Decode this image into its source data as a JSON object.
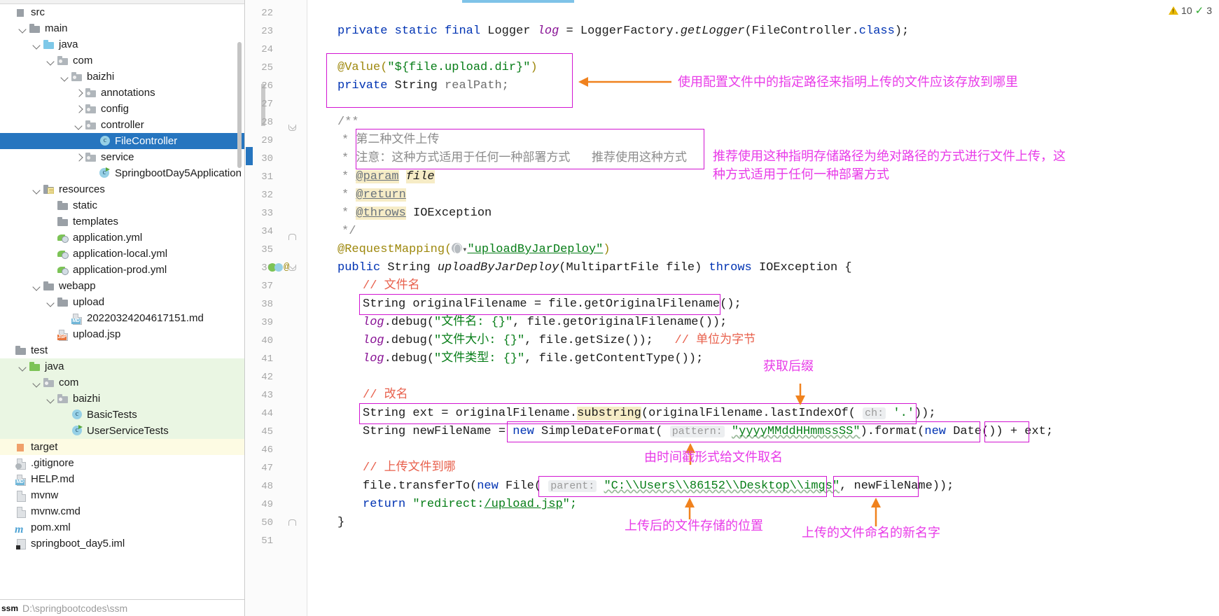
{
  "sidebar": {
    "scroll_path": "D:\\springbootcodes\\ssm",
    "scroll_badge": "ssm",
    "items": [
      {
        "label": "src",
        "indent": 0,
        "arrow": "none",
        "icon": "src-icon",
        "state": "normal"
      },
      {
        "label": "main",
        "indent": 1,
        "arrow": "down",
        "icon": "folder-icon",
        "state": "normal"
      },
      {
        "label": "java",
        "indent": 2,
        "arrow": "down",
        "icon": "folder-blue-icon",
        "state": "normal"
      },
      {
        "label": "com",
        "indent": 3,
        "arrow": "down",
        "icon": "package-icon",
        "state": "normal"
      },
      {
        "label": "baizhi",
        "indent": 4,
        "arrow": "down",
        "icon": "package-icon",
        "state": "normal"
      },
      {
        "label": "annotations",
        "indent": 5,
        "arrow": "right",
        "icon": "package-icon",
        "state": "normal"
      },
      {
        "label": "config",
        "indent": 5,
        "arrow": "right",
        "icon": "package-icon",
        "state": "normal"
      },
      {
        "label": "controller",
        "indent": 5,
        "arrow": "down",
        "icon": "package-icon",
        "state": "normal"
      },
      {
        "label": "FileController",
        "indent": 6,
        "arrow": "none",
        "icon": "java-class-icon",
        "state": "selected"
      },
      {
        "label": "service",
        "indent": 5,
        "arrow": "right",
        "icon": "package-icon",
        "state": "normal"
      },
      {
        "label": "SpringbootDay5Application",
        "indent": 6,
        "arrow": "none",
        "icon": "spring-boot-class-icon",
        "state": "normal"
      },
      {
        "label": "resources",
        "indent": 2,
        "arrow": "down",
        "icon": "resources-folder-icon",
        "state": "normal"
      },
      {
        "label": "static",
        "indent": 3,
        "arrow": "none",
        "icon": "folder-icon",
        "state": "normal"
      },
      {
        "label": "templates",
        "indent": 3,
        "arrow": "none",
        "icon": "folder-icon",
        "state": "normal"
      },
      {
        "label": "application.yml",
        "indent": 3,
        "arrow": "none",
        "icon": "yaml-spring-icon",
        "state": "normal"
      },
      {
        "label": "application-local.yml",
        "indent": 3,
        "arrow": "none",
        "icon": "yaml-spring-icon",
        "state": "normal"
      },
      {
        "label": "application-prod.yml",
        "indent": 3,
        "arrow": "none",
        "icon": "yaml-spring-icon",
        "state": "normal"
      },
      {
        "label": "webapp",
        "indent": 2,
        "arrow": "down",
        "icon": "folder-icon",
        "state": "normal"
      },
      {
        "label": "upload",
        "indent": 3,
        "arrow": "down",
        "icon": "folder-icon",
        "state": "normal"
      },
      {
        "label": "20220324204617151.md",
        "indent": 4,
        "arrow": "none",
        "icon": "markdown-file-icon",
        "state": "normal"
      },
      {
        "label": "upload.jsp",
        "indent": 3,
        "arrow": "none",
        "icon": "jsp-file-icon",
        "state": "normal"
      },
      {
        "label": "test",
        "indent": 0,
        "arrow": "none",
        "icon": "folder-icon",
        "state": "normal"
      },
      {
        "label": "java",
        "indent": 1,
        "arrow": "down",
        "icon": "folder-green-icon",
        "state": "test"
      },
      {
        "label": "com",
        "indent": 2,
        "arrow": "down",
        "icon": "package-icon",
        "state": "test"
      },
      {
        "label": "baizhi",
        "indent": 3,
        "arrow": "down",
        "icon": "package-icon",
        "state": "test"
      },
      {
        "label": "BasicTests",
        "indent": 4,
        "arrow": "none",
        "icon": "java-class-icon",
        "state": "test"
      },
      {
        "label": "UserServiceTests",
        "indent": 4,
        "arrow": "none",
        "icon": "java-class-run-icon",
        "state": "test"
      },
      {
        "label": "target",
        "indent": 0,
        "arrow": "none",
        "icon": "target-folder-icon",
        "state": "excluded"
      },
      {
        "label": ".gitignore",
        "indent": 0,
        "arrow": "none",
        "icon": "gitignore-file-icon",
        "state": "normal"
      },
      {
        "label": "HELP.md",
        "indent": 0,
        "arrow": "none",
        "icon": "markdown-file-icon",
        "state": "normal"
      },
      {
        "label": "mvnw",
        "indent": 0,
        "arrow": "none",
        "icon": "file-icon",
        "state": "normal"
      },
      {
        "label": "mvnw.cmd",
        "indent": 0,
        "arrow": "none",
        "icon": "cmd-file-icon",
        "state": "normal"
      },
      {
        "label": "pom.xml",
        "indent": 0,
        "arrow": "none",
        "icon": "maven-file-icon",
        "state": "normal"
      },
      {
        "label": "springboot_day5.iml",
        "indent": 0,
        "arrow": "none",
        "icon": "iml-file-icon",
        "state": "normal"
      }
    ]
  },
  "inspections": {
    "warning_icon": "warning-triangle-icon",
    "warning_count": "10",
    "check_icon": "check-mark-icon",
    "check_count": "3"
  },
  "editor": {
    "line_numbers": [
      "22",
      "23",
      "24",
      "25",
      "26",
      "27",
      "28",
      "29",
      "30",
      "31",
      "32",
      "33",
      "34",
      "35",
      "36",
      "37",
      "38",
      "39",
      "40",
      "41",
      "42",
      "43",
      "44",
      "45",
      "46",
      "47",
      "48",
      "49",
      "50",
      "51"
    ],
    "lines": [
      {
        "n": "22",
        "text": ""
      },
      {
        "n": "23",
        "text": "    private static final Logger log = LoggerFactory.getLogger(FileController.class);"
      },
      {
        "n": "24",
        "text": ""
      },
      {
        "n": "25",
        "text": "    @Value(\"${file.upload.dir}\")"
      },
      {
        "n": "26",
        "text": "    private String realPath;"
      },
      {
        "n": "27",
        "text": ""
      },
      {
        "n": "28",
        "text": "    /**"
      },
      {
        "n": "29",
        "text": "     * 第二种文件上传"
      },
      {
        "n": "30",
        "text": "     * 注意：这种方式适用于任何一种部署方式   推荐使用这种方式"
      },
      {
        "n": "31",
        "text": "     * @param file"
      },
      {
        "n": "32",
        "text": "     * @return"
      },
      {
        "n": "33",
        "text": "     * @throws IOException"
      },
      {
        "n": "34",
        "text": "     */"
      },
      {
        "n": "35",
        "text": "    @RequestMapping(\"uploadByJarDeploy\")"
      },
      {
        "n": "36",
        "text": "    public String uploadByJarDeploy(MultipartFile file) throws IOException {"
      },
      {
        "n": "37",
        "text": "        // 文件名"
      },
      {
        "n": "38",
        "text": "        String originalFilename = file.getOriginalFilename();"
      },
      {
        "n": "39",
        "text": "        log.debug(\"文件名: {}\", file.getOriginalFilename());"
      },
      {
        "n": "40",
        "text": "        log.debug(\"文件大小: {}\", file.getSize());   // 单位为字节"
      },
      {
        "n": "41",
        "text": "        log.debug(\"文件类型: {}\", file.getContentType());"
      },
      {
        "n": "42",
        "text": ""
      },
      {
        "n": "43",
        "text": "        // 改名"
      },
      {
        "n": "44",
        "text": "        String ext = originalFilename.substring(originalFilename.lastIndexOf( ch: '.'));"
      },
      {
        "n": "45",
        "text": "        String newFileName = new SimpleDateFormat( pattern: \"yyyyMMddHHmmssSS\").format(new Date()) + ext;"
      },
      {
        "n": "46",
        "text": ""
      },
      {
        "n": "47",
        "text": "        // 上传文件到哪"
      },
      {
        "n": "48",
        "text": "        file.transferTo(new File( parent: \"C:\\\\Users\\\\86152\\\\Desktop\\\\imgs\", newFileName));"
      },
      {
        "n": "49",
        "text": "        return \"redirect:/upload.jsp\";"
      },
      {
        "n": "50",
        "text": "    }"
      },
      {
        "n": "51",
        "text": ""
      }
    ],
    "tokens": {
      "l23_private": "private",
      "l23_static": "static",
      "l23_final": "final",
      "l23_logger": "Logger",
      "l23_log": "log",
      "l23_eq": "= LoggerFactory.",
      "l23_getlogger": "getLogger",
      "l23_rest": "(FileController.",
      "l23_class": "class",
      ";": ");",
      "l25_value": "@Value(",
      "l25_str": "\"${file.upload.dir}\"",
      "l25_close": ")",
      "l26_private": "private",
      "l26_string": "String",
      "l26_realpath": "realPath;",
      "l28": "/**",
      "l29_star": "*",
      "l29_cn": "第二种文件上传",
      "l30_star": "*",
      "l30_cn": "注意：这种方式适用于任何一种部署方式   推荐使用这种方式",
      "l31_star": "*",
      "l31_tag": "@param",
      "l31_val": "file",
      "l32_star": "*",
      "l32_tag": "@return",
      "l33_star": "*",
      "l33_tag": "@throws",
      "l33_val": "IOException",
      "l34": "*/",
      "l35_ann": "@RequestMapping(",
      "l35_globe": "globe-icon",
      "l35_str": "\"uploadByJarDeploy\"",
      "l35_close": ")",
      "l36_public": "public",
      "l36_string": "String",
      "l36_name": "uploadByJarDeploy",
      "l36_args": "(MultipartFile file)",
      "l36_throws": "throws",
      "l36_ex": "IOException {",
      "l37": "// 文件名",
      "l38": "String originalFilename = file.getOriginalFilename();",
      "l39_log": "log",
      "l39_rest": ".debug(",
      "l39_str": "\"文件名: {}\"",
      "l39_tail": ", file.getOriginalFilename());",
      "l40_log": "log",
      "l40_rest": ".debug(",
      "l40_str": "\"文件大小: {}\"",
      "l40_tail": ", file.getSize());",
      "l40_cmt": "// 单位为字节",
      "l41_log": "log",
      "l41_rest": ".debug(",
      "l41_str": "\"文件类型: {}\"",
      "l41_tail": ", file.getContentType());",
      "l43": "// 改名",
      "l44_a": "String ext = originalFilename.",
      "l44_sub": "substring",
      "l44_b": "(originalFilename.lastIndexOf(",
      "l44_hint": "ch:",
      "l44_c": "'.'",
      "l44_d": "));",
      "l45_a": "String newFileName = ",
      "l45_new": "new",
      "l45_b": " SimpleDateFormat(",
      "l45_hint": "pattern:",
      "l45_str": "\"yyyyMMddHHmmssSS\"",
      "l45_c": ").format(",
      "l45_new2": "new",
      "l45_d": " Date())",
      "l45_plus": "+",
      "l45_ext": "ext;",
      "l47": "// 上传文件到哪",
      "l48_a": "file.transferTo(",
      "l48_new": "new",
      "l48_b": " File(",
      "l48_hint": "parent:",
      "l48_path": "\"C:\\\\Users\\\\86152\\\\Desktop\\\\imgs\"",
      "l48_comma": ",",
      "l48_name": "newFileName",
      "l48_close": "));",
      "l49_ret": "return",
      "l49_str_a": "\"redirect:",
      "l49_link": "/upload.jsp",
      "l49_str_b": "\";",
      "l50": "}"
    }
  },
  "annotations": [
    {
      "id": "anno-value-path",
      "text": "使用配置文件中的指定路径来指明上传的文件应该存放到哪里"
    },
    {
      "id": "anno-recommend",
      "text": "推荐使用这种指明存储路径为绝对路径的方式进行文件上传，这\n种方式适用于任何一种部署方式"
    },
    {
      "id": "anno-get-ext",
      "text": "获取后缀"
    },
    {
      "id": "anno-timestamp-name",
      "text": "由时间戳形式给文件取名"
    },
    {
      "id": "anno-storage-location",
      "text": "上传后的文件存储的位置"
    },
    {
      "id": "anno-new-filename",
      "text": "上传的文件命名的新名字"
    }
  ],
  "colors": {
    "annotation": "#e83be8",
    "box_border": "#d215d2",
    "selection": "#2675bf",
    "arrow": "#f0821e"
  }
}
